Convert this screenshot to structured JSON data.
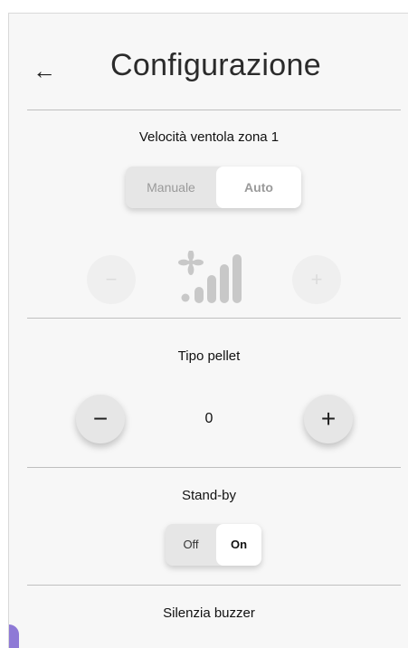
{
  "header": {
    "back_icon": "arrow-left-icon",
    "title": "Configurazione"
  },
  "fan": {
    "label": "Velocità ventola zona 1",
    "mode": {
      "manual": "Manuale",
      "auto": "Auto",
      "selected": "Auto"
    },
    "minus": "−",
    "plus": "+",
    "level_icon": "fan-speed-level-icon"
  },
  "pellet": {
    "label": "Tipo pellet",
    "minus": "−",
    "plus": "+",
    "value": "0"
  },
  "standby": {
    "label": "Stand-by",
    "off": "Off",
    "on": "On",
    "selected": "On"
  },
  "buzzer": {
    "label": "Silenzia buzzer"
  },
  "colors": {
    "background": "#f7f7f7",
    "accent": "#8e79d6",
    "disabled": "#dcdcdc"
  }
}
